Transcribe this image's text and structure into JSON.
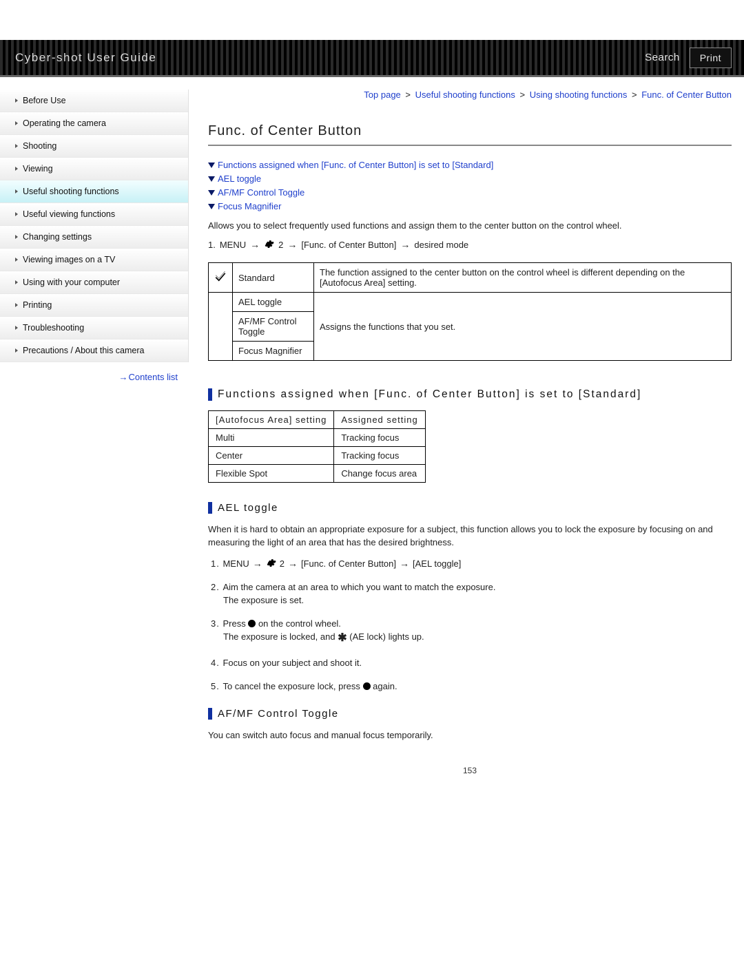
{
  "header": {
    "title": "Cyber-shot User Guide",
    "search": "Search",
    "print": "Print"
  },
  "sidebar": {
    "items": [
      {
        "label": "Before Use"
      },
      {
        "label": "Operating the camera"
      },
      {
        "label": "Shooting"
      },
      {
        "label": "Viewing"
      },
      {
        "label": "Useful shooting functions",
        "active": true
      },
      {
        "label": "Useful viewing functions"
      },
      {
        "label": "Changing settings"
      },
      {
        "label": "Viewing images on a TV"
      },
      {
        "label": "Using with your computer"
      },
      {
        "label": "Printing"
      },
      {
        "label": "Troubleshooting"
      },
      {
        "label": "Precautions / About this camera"
      }
    ],
    "contents_link": "Contents list"
  },
  "breadcrumb": {
    "items": [
      "Top page",
      "Useful shooting functions",
      "Using shooting functions",
      "Func. of Center Button"
    ]
  },
  "page_title": "Func. of Center Button",
  "anchors": [
    "Functions assigned when [Func. of Center Button] is set to [Standard]",
    "AEL toggle",
    "AF/MF Control Toggle",
    "Focus Magnifier"
  ],
  "intro": "Allows you to select frequently used functions and assign them to the center button on the control wheel.",
  "path1": {
    "num": "1.",
    "menu": "MENU",
    "gear_num": "2",
    "item": "[Func. of Center Button]",
    "end": "desired mode"
  },
  "modes_table": {
    "rows": [
      {
        "check": true,
        "name": "Standard",
        "desc": "The function assigned to the center button on the control wheel is different depending on the [Autofocus Area] setting."
      },
      {
        "name": "AEL toggle"
      },
      {
        "name": "AF/MF Control Toggle"
      },
      {
        "name": "Focus Magnifier"
      }
    ],
    "group_desc": "Assigns the functions that you set."
  },
  "section_standard": {
    "title": "Functions assigned when [Func. of Center Button] is set to [Standard]",
    "table": {
      "head": [
        "[Autofocus Area] setting",
        "Assigned setting"
      ],
      "rows": [
        [
          "Multi",
          "Tracking focus"
        ],
        [
          "Center",
          "Tracking focus"
        ],
        [
          "Flexible Spot",
          "Change focus area"
        ]
      ]
    }
  },
  "section_ael": {
    "title": "AEL toggle",
    "para": "When it is hard to obtain an appropriate exposure for a subject, this function allows you to lock the exposure by focusing on and measuring the light of an area that has the desired brightness.",
    "steps": {
      "s1": {
        "menu": "MENU",
        "gear_num": "2",
        "item": "[Func. of Center Button]",
        "end": "[AEL toggle]"
      },
      "s2_a": "Aim the camera at an area to which you want to match the exposure.",
      "s2_b": "The exposure is set.",
      "s3_a": "Press",
      "s3_b": "on the control wheel.",
      "s3_c": "The exposure is locked, and",
      "s3_d": "(AE lock) lights up.",
      "s4": "Focus on your subject and shoot it.",
      "s5_a": "To cancel the exposure lock, press",
      "s5_b": "again."
    }
  },
  "section_afmf": {
    "title": "AF/MF Control Toggle",
    "para": "You can switch auto focus and manual focus temporarily."
  },
  "page_number": "153"
}
